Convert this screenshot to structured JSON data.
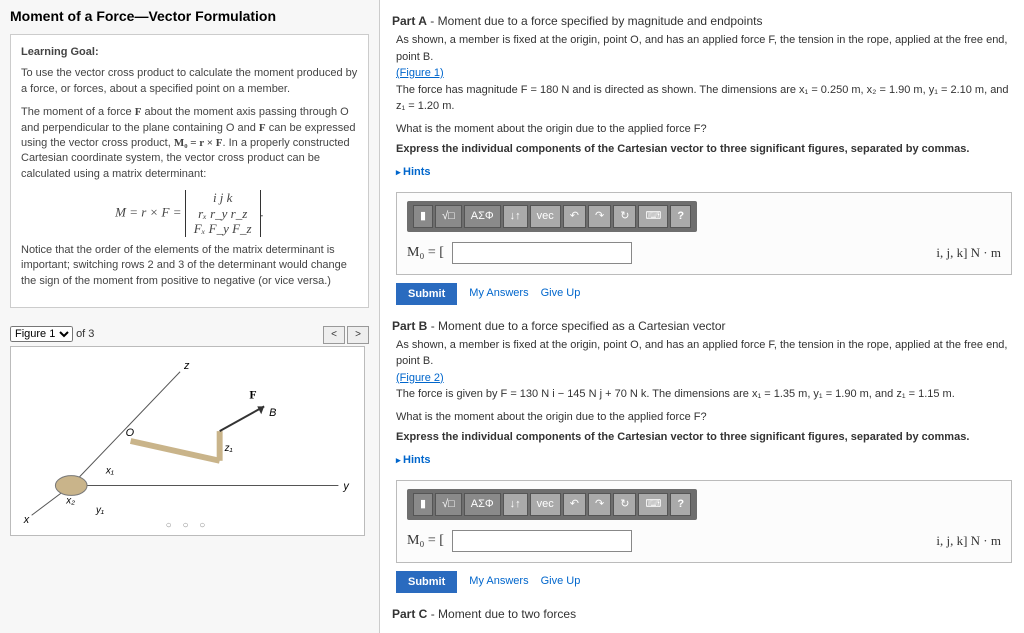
{
  "title": "Moment of a Force—Vector Formulation",
  "learning": {
    "heading": "Learning Goal:",
    "p1": "To use the vector cross product to calculate the moment produced by a force, or forces, about a specified point on a member.",
    "p2a": "The moment of a force ",
    "p2b": " about the moment axis passing through O and perpendicular to the plane containing O and ",
    "p2c": " can be expressed using the vector cross product, ",
    "p2eq": "M₀ = r × F",
    "p2d": ". In a properly constructed Cartesian coordinate system, the vector cross product can be calculated using a matrix determinant:",
    "matrix_lhs": "M = r × F =",
    "matrix_row1": "i    j    k",
    "matrix_row2": "rₓ   r_y   r_z",
    "matrix_row3": "Fₓ   F_y   F_z",
    "p3": "Notice that the order of the elements of the matrix determinant is important; switching rows 2 and 3 of the determinant would change the sign of the moment from positive to negative (or vice versa.)"
  },
  "figure": {
    "selector_label": "Figure 1",
    "of_label": "of 3",
    "prev": "<",
    "next": ">",
    "dots": "○ ○ ○",
    "labels": {
      "x": "x",
      "y": "y",
      "z": "z",
      "O": "O",
      "B": "B",
      "F": "F",
      "x1": "x₁",
      "x2": "x₂",
      "y1": "y₁",
      "z1": "z₁"
    }
  },
  "partA": {
    "label": "Part A",
    "title": "- Moment due to a force specified by magnitude and endpoints",
    "txt1": "As shown, a member is fixed at the origin, point O, and has an applied force F, the tension in the rope, applied at the free end, point B.",
    "fig_link": "(Figure 1)",
    "txt2": "The force has magnitude F = 180 N and is directed as shown. The dimensions are x₁ = 0.250 m, x₂ = 1.90 m, y₁ = 2.10 m, and z₁ = 1.20 m.",
    "q": "What is the moment about the origin due to the applied force F?",
    "instr": "Express the individual components of the Cartesian vector to three significant figures, separated by commas.",
    "hints": "Hints",
    "eq_lhs": "M₀ = [",
    "units": "i, j, k] N · m",
    "submit": "Submit",
    "my_ans": "My Answers",
    "giveup": "Give Up"
  },
  "partB": {
    "label": "Part B",
    "title": "- Moment due to a force specified as a Cartesian vector",
    "txt1": "As shown, a member is fixed at the origin, point O, and has an applied force F, the tension in the rope, applied at the free end, point B.",
    "fig_link": "(Figure 2)",
    "txt2": "The force is given by F = 130 N i − 145 N j + 70 N k. The dimensions are x₁ = 1.35 m, y₁ = 1.90 m, and z₁ = 1.15 m.",
    "q": "What is the moment about the origin due to the applied force F?",
    "instr": "Express the individual components of the Cartesian vector to three significant figures, separated by commas.",
    "hints": "Hints",
    "eq_lhs": "M₀ = [",
    "units": "i, j, k] N · m",
    "submit": "Submit",
    "my_ans": "My Answers",
    "giveup": "Give Up"
  },
  "partC": {
    "label": "Part C",
    "title": "- Moment due to two forces"
  },
  "toolbar": {
    "b1": "▮",
    "b2": "√□",
    "b3": "ΑΣΦ",
    "b4": "↓↑",
    "b5": "vec",
    "b6": "↶",
    "b7": "↷",
    "b8": "↻",
    "b9": "⌨",
    "bq": "?"
  }
}
